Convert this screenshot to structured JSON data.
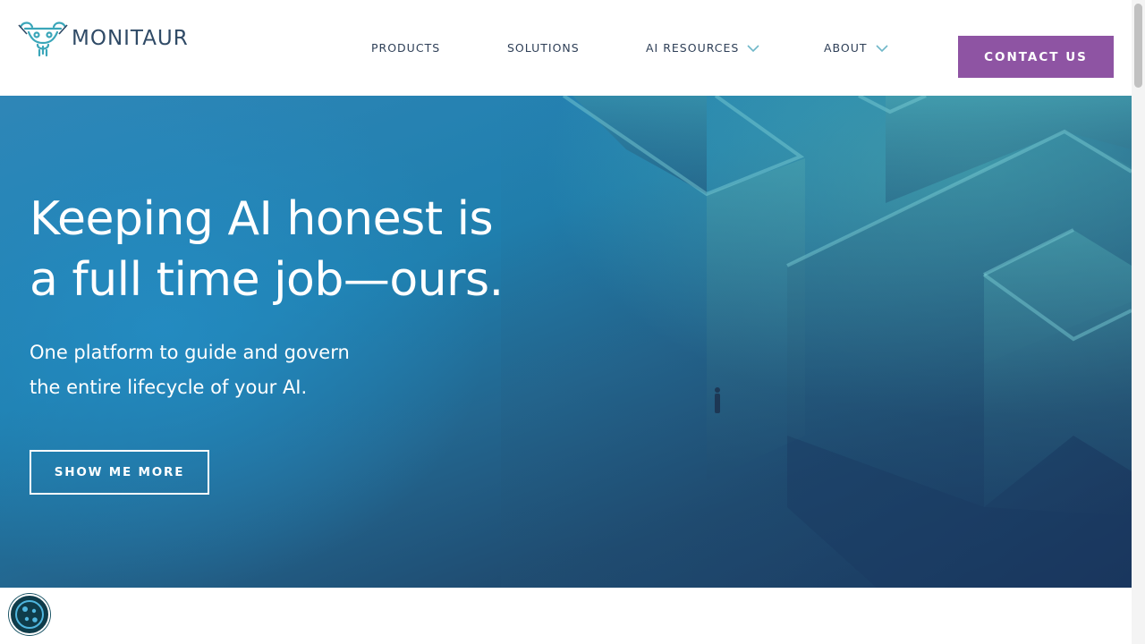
{
  "brand": {
    "name": "MONITAUR",
    "colors": {
      "text": "#2f4a66",
      "icon": "#3aa6b9"
    }
  },
  "nav": {
    "items": [
      {
        "label": "PRODUCTS",
        "has_dropdown": false
      },
      {
        "label": "SOLUTIONS",
        "has_dropdown": false
      },
      {
        "label": "AI RESOURCES",
        "has_dropdown": true,
        "icon": "chevron-down-icon"
      },
      {
        "label": "ABOUT",
        "has_dropdown": true,
        "icon": "chevron-down-icon"
      }
    ],
    "cta_label": "CONTACT US",
    "cta_color": "#8e54a3"
  },
  "hero": {
    "title_line1": "Keeping AI honest is",
    "title_line2": "a full time job—ours.",
    "subtitle_line1": "One platform to guide and govern",
    "subtitle_line2": "the entire lifecycle of your AI.",
    "button_label": "SHOW ME MORE"
  },
  "cookie": {
    "icon": "cookie-icon"
  }
}
